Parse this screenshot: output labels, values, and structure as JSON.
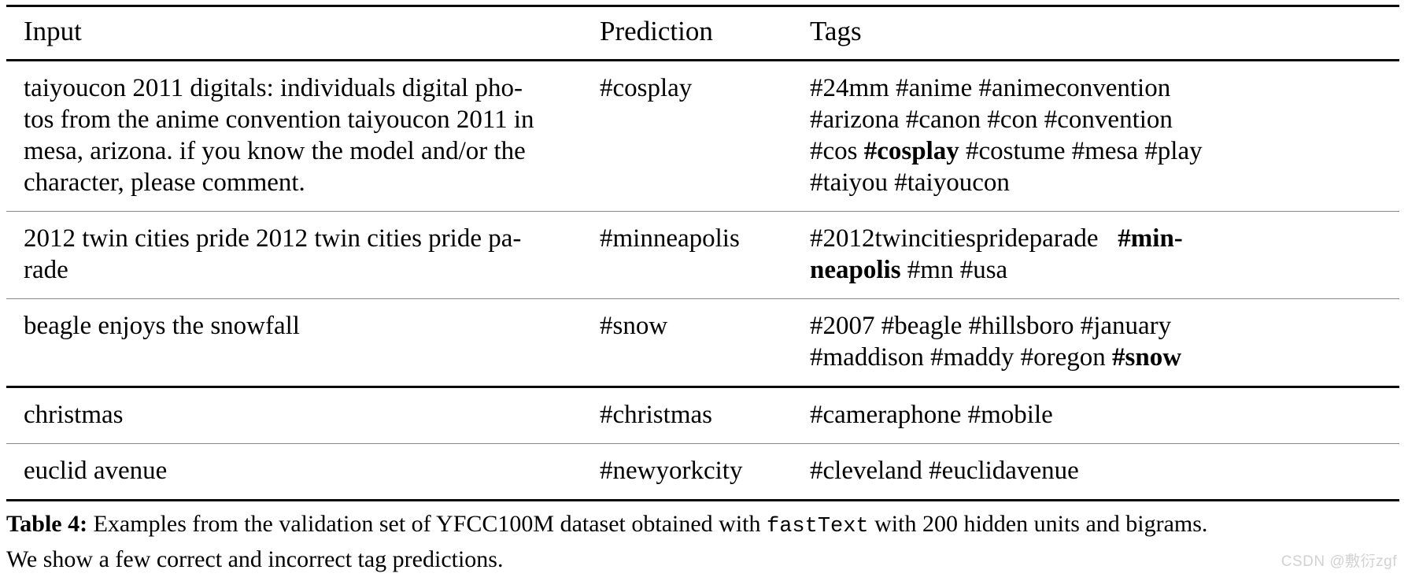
{
  "table": {
    "columns": [
      "Input",
      "Prediction",
      "Tags"
    ],
    "rows": [
      {
        "input_lines": [
          "taiyoucon 2011 digitals:  individuals digital pho-",
          "tos from the anime convention taiyoucon 2011 in",
          "mesa, arizona.  if you know the model and/or the",
          "character, please comment."
        ],
        "prediction": "#cosplay",
        "tag_lines": [
          [
            {
              "t": "#24mm  #anime  #animeconvention",
              "b": false
            }
          ],
          [
            {
              "t": "#arizona  #canon  #con  #convention",
              "b": false
            }
          ],
          [
            {
              "t": "#cos ",
              "b": false
            },
            {
              "t": "#cosplay",
              "b": true
            },
            {
              "t": " #costume #mesa #play",
              "b": false
            }
          ],
          [
            {
              "t": "#taiyou #taiyoucon",
              "b": false
            }
          ]
        ]
      },
      {
        "input_lines": [
          "2012 twin cities pride 2012 twin cities pride pa-",
          "rade"
        ],
        "prediction": "#minneapolis",
        "tag_lines": [
          [
            {
              "t": "#2012twincitiesprideparade   ",
              "b": false
            },
            {
              "t": "#min-",
              "b": true
            }
          ],
          [
            {
              "t": "neapolis",
              "b": true
            },
            {
              "t": " #mn #usa",
              "b": false
            }
          ]
        ]
      },
      {
        "input_lines": [
          "beagle enjoys the snowfall"
        ],
        "prediction": "#snow",
        "tag_lines": [
          [
            {
              "t": "#2007  #beagle  #hillsboro  #january",
              "b": false
            }
          ],
          [
            {
              "t": "#maddison #maddy #oregon ",
              "b": false
            },
            {
              "t": "#snow",
              "b": true
            }
          ]
        ]
      },
      {
        "input_lines": [
          "christmas"
        ],
        "prediction": "#christmas",
        "tag_lines": [
          [
            {
              "t": "#cameraphone #mobile",
              "b": false
            }
          ]
        ]
      },
      {
        "input_lines": [
          "euclid avenue"
        ],
        "prediction": "#newyorkcity",
        "tag_lines": [
          [
            {
              "t": "#cleveland #euclidavenue",
              "b": false
            }
          ]
        ]
      }
    ]
  },
  "caption": {
    "label": "Table 4:",
    "line1_a": " Examples from the validation set of YFCC100M dataset obtained with ",
    "line1_mono": "fastText",
    "line1_b": " with 200 hidden units and bigrams.",
    "line2": "We show a few correct and incorrect tag predictions."
  },
  "watermark": {
    "text": "CSDN @敷衍zgf"
  }
}
